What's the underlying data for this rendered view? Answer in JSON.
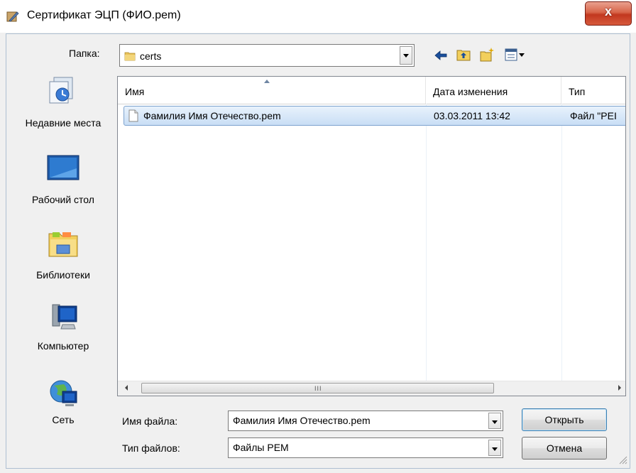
{
  "window": {
    "title": "Сертификат ЭЦП (ФИО.pem)",
    "close_label": "x"
  },
  "folder_bar": {
    "label": "Папка:",
    "current_folder": "certs"
  },
  "places": [
    {
      "label": "Недавние места",
      "icon": "recent-places-icon"
    },
    {
      "label": "Рабочий стол",
      "icon": "desktop-icon"
    },
    {
      "label": "Библиотеки",
      "icon": "libraries-icon"
    },
    {
      "label": "Компьютер",
      "icon": "computer-icon"
    },
    {
      "label": "Сеть",
      "icon": "network-icon"
    }
  ],
  "file_list": {
    "columns": [
      "Имя",
      "Дата изменения",
      "Тип"
    ],
    "rows": [
      {
        "name": "Фамилия Имя Отечество.pem",
        "date": "03.03.2011 13:42",
        "type": "Файл \"PEI"
      }
    ],
    "scroll_grip": "III"
  },
  "bottom": {
    "filename_label": "Имя файла:",
    "filename_value": "Фамилия Имя Отечество.pem",
    "filetype_label": "Тип файлов:",
    "filetype_value": "Файлы PEM",
    "open_button": "Открыть",
    "cancel_button": "Отмена"
  },
  "colors": {
    "selection": "#cce4f7",
    "close_button": "#c9432a",
    "frame": "#f0f0f0"
  }
}
